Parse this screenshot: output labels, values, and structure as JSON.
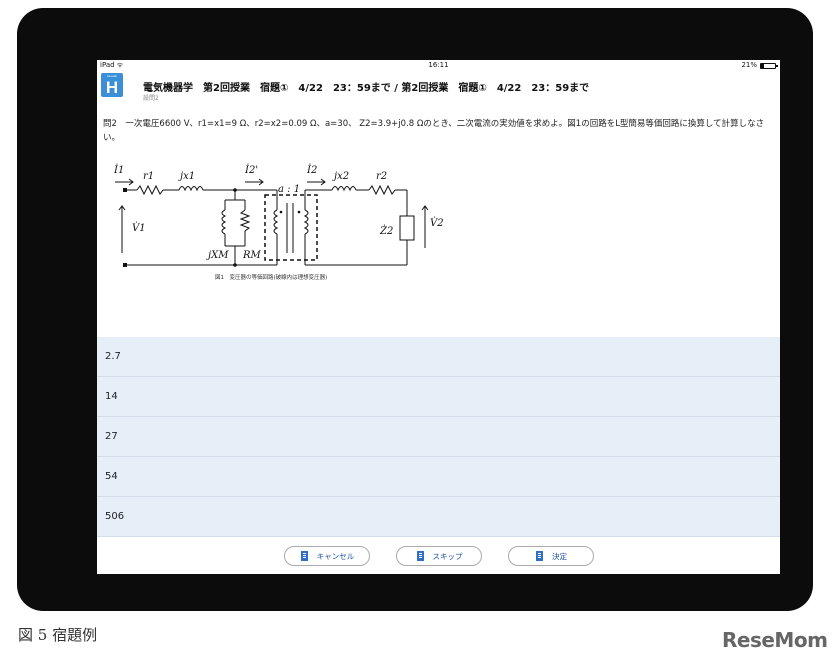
{
  "statusbar": {
    "device": "iPad ᯤ",
    "time": "16:11",
    "battery": "21%",
    "battery_level": 0.21
  },
  "header": {
    "logo_text": "H",
    "logo_small": "Hoodai",
    "title": "電気機器学　第2回授業　宿題①　4/22　23：59まで / 第2回授業　宿題①　4/22　23：59まで",
    "subtitle": "設問2"
  },
  "question": {
    "text": "問2　一次電圧6600 V、r1=x1=9 Ω、r2=x2=0.09 Ω、a=30、 Z2=3.9+j0.8 Ωのとき、二次電流の実効値を求めよ。図1の回路をL型簡易等価回路に換算して計算しなさい。"
  },
  "figure": {
    "label_I1": "İ1",
    "label_r1": "r1",
    "label_jx1": "jx1",
    "label_I2p": "İ2'",
    "label_I2": "İ2",
    "label_jx2": "jx2",
    "label_r2": "r2",
    "label_ratio": "a : 1",
    "label_V1": "V̇1",
    "label_jXM": "jXM",
    "label_RM": "RM",
    "label_Z2": "Ż2",
    "label_V2": "V̇2",
    "caption": "図1　変圧器の等価回路(破線内は理想変圧器)"
  },
  "options": [
    "2.7",
    "14",
    "27",
    "54",
    "506"
  ],
  "buttons": {
    "cancel": "キャンセル",
    "skip": "スキップ",
    "decide": "決定"
  },
  "page_caption": "図 5  宿題例",
  "brand": "ReseMom"
}
